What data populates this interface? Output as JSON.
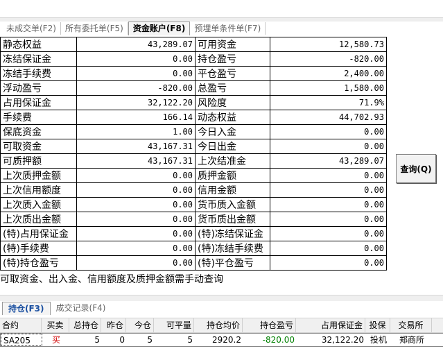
{
  "tabs": [
    {
      "label": "未成交单(F2)",
      "active": false
    },
    {
      "label": "所有委托单(F5)",
      "active": false
    },
    {
      "label": "资金账户(F8)",
      "active": true
    },
    {
      "label": "预埋单条件单(F7)",
      "active": false
    }
  ],
  "account_rows": [
    {
      "l1": "静态权益",
      "v1": "43,289.07",
      "l2": "可用资金",
      "v2": "12,580.73"
    },
    {
      "l1": "冻结保证金",
      "v1": "0.00",
      "l2": "持仓盈亏",
      "v2": "-820.00"
    },
    {
      "l1": "冻结手续费",
      "v1": "0.00",
      "l2": "平仓盈亏",
      "v2": "2,400.00"
    },
    {
      "l1": "浮动盈亏",
      "v1": "-820.00",
      "l2": "总盈亏",
      "v2": "1,580.00"
    },
    {
      "l1": "占用保证金",
      "v1": "32,122.20",
      "l2": "风险度",
      "v2": "71.9%"
    },
    {
      "l1": "手续费",
      "v1": "166.14",
      "l2": "动态权益",
      "v2": "44,702.93"
    },
    {
      "l1": "保底资金",
      "v1": "1.00",
      "l2": "今日入金",
      "v2": "0.00"
    },
    {
      "l1": "可取资金",
      "v1": "43,167.31",
      "l2": "今日出金",
      "v2": "0.00"
    },
    {
      "l1": "可质押额",
      "v1": "43,167.31",
      "l2": "上次结准金",
      "v2": "43,289.07"
    },
    {
      "l1": "上次质押金额",
      "v1": "0.00",
      "l2": "质押金额",
      "v2": "0.00"
    },
    {
      "l1": "上次信用额度",
      "v1": "0.00",
      "l2": "信用金额",
      "v2": "0.00"
    },
    {
      "l1": "上次质入金额",
      "v1": "0.00",
      "l2": "货币质入金额",
      "v2": "0.00"
    },
    {
      "l1": "上次质出金额",
      "v1": "0.00",
      "l2": "货币质出金额",
      "v2": "0.00"
    },
    {
      "l1": "(特)占用保证金",
      "v1": "0.00",
      "l2": "(特)冻结保证金",
      "v2": "0.00"
    },
    {
      "l1": "(特)手续费",
      "v1": "0.00",
      "l2": "(特)冻结手续费",
      "v2": "0.00"
    },
    {
      "l1": "(特)持仓盈亏",
      "v1": "0.00",
      "l2": "(特)平仓盈亏",
      "v2": "0.00"
    }
  ],
  "query_button": "查询(Q)",
  "note": "可取资金、出入金、信用额度及质押金额需手动查询",
  "bottom_tabs": [
    {
      "label": "持仓(F3)",
      "active": true
    },
    {
      "label": "成交记录(F4)",
      "active": false
    }
  ],
  "positions_columns": [
    "合约",
    "买卖",
    "总持仓",
    "昨仓",
    "今仓",
    "可平量",
    "持仓均价",
    "持仓盈亏",
    "占用保证金",
    "投保",
    "交易所"
  ],
  "positions": [
    {
      "contract": "SA205",
      "side": "买",
      "total": "5",
      "yesterday": "0",
      "today": "5",
      "closable": "5",
      "avg_price": "2920.2",
      "pnl": "-820.00",
      "margin": "32,122.20",
      "hedge": "投机",
      "exchange": "郑商所"
    }
  ],
  "colors": {
    "buy": "#d00000",
    "pnl_negative": "#008000",
    "active_bottom_tab": "#1a4fa0"
  }
}
